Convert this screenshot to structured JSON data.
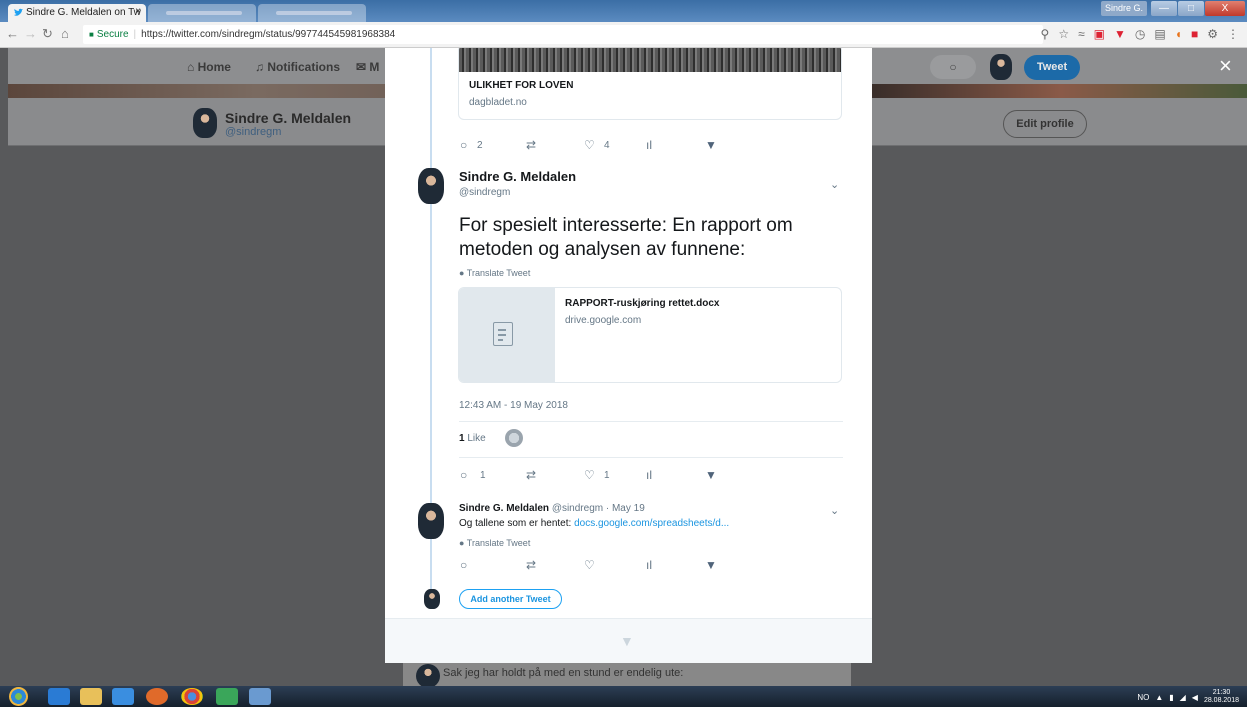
{
  "browser": {
    "active_tab_title": "Sindre G. Meldalen on Tw",
    "tab_close": "×",
    "secure_label": "Secure",
    "url": "https://twitter.com/sindregm/status/997744545981968384",
    "user_button": "Sindre G.",
    "win_min": "—",
    "win_max": "□",
    "win_close": "X"
  },
  "twitter_nav": {
    "home": "Home",
    "notifications": "Notifications",
    "messages_partial": "M",
    "tweet_button": "Tweet",
    "close": "×"
  },
  "profile": {
    "name": "Sindre G. Meldalen",
    "handle": "@sindregm",
    "edit_profile": "Edit profile"
  },
  "previous_tweet": {
    "card_title": "ULIKHET FOR LOVEN",
    "card_domain": "dagbladet.no",
    "replies": "2",
    "likes": "4"
  },
  "main_tweet": {
    "author_name": "Sindre G. Meldalen",
    "author_handle": "@sindregm",
    "text": "For spesielt interesserte: En rapport om metoden og analysen av funnene:",
    "translate": "Translate Tweet",
    "card_title": "RAPPORT-ruskjøring rettet.docx",
    "card_domain": "drive.google.com",
    "timestamp": "12:43 AM - 19 May 2018",
    "like_count": "1",
    "like_label": "Like",
    "replies": "1",
    "likes": "1"
  },
  "reply_tweet": {
    "author_name": "Sindre G. Meldalen",
    "meta": "@sindregm · May 19",
    "text_prefix": "Og tallene som er hentet: ",
    "link": "docs.google.com/spreadsheets/d...",
    "translate": "Translate Tweet"
  },
  "add_tweet": "Add another Tweet",
  "background_tweet_text": "Sak jeg har holdt på med en stund er endelig ute:",
  "taskbar": {
    "lang": "NO",
    "time": "21:30",
    "date": "28.08.2018"
  },
  "colors": {
    "twitter_blue": "#1da1f2",
    "link_blue": "#1b95e0",
    "secure_green": "#0b8043"
  }
}
